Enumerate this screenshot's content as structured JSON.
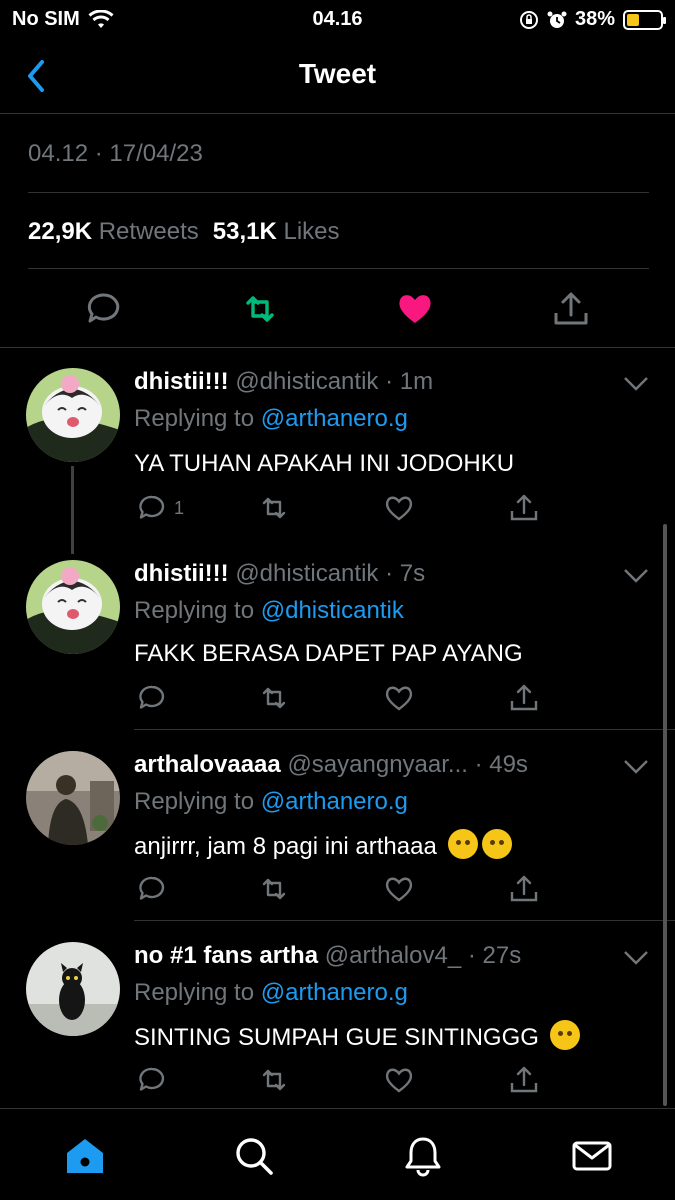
{
  "status_bar": {
    "carrier": "No SIM",
    "time": "04.16",
    "battery": "38%"
  },
  "nav": {
    "title": "Tweet"
  },
  "tweet": {
    "timestamp": "04.12 · 17/04/23",
    "retweets_count": "22,9K",
    "retweets_label": "Retweets",
    "likes_count": "53,1K",
    "likes_label": "Likes"
  },
  "replies": [
    {
      "display_name": "dhistii!!!",
      "handle": "@dhisticantik · 1m",
      "replying_label": "Replying to",
      "replying_to": "@arthanero.g",
      "text": "YA TUHAN APAKAH INI JODOHKU",
      "reply_count": "1"
    },
    {
      "display_name": "dhistii!!!",
      "handle": "@dhisticantik · 7s",
      "replying_label": "Replying to",
      "replying_to": "@dhisticantik",
      "text": "FAKK BERASA DAPET PAP AYANG",
      "reply_count": ""
    },
    {
      "display_name": "arthalovaaaa",
      "handle": "@sayangnyaar... · 49s",
      "replying_label": "Replying to",
      "replying_to": "@arthanero.g",
      "text": "anjirrr, jam 8 pagi ini arthaaa",
      "reply_count": ""
    },
    {
      "display_name": "no #1 fans artha",
      "handle": "@arthalov4_ · 27s",
      "replying_label": "Replying to",
      "replying_to": "@arthanero.g",
      "text": "SINTING SUMPAH GUE SINTINGGG",
      "reply_count": ""
    }
  ],
  "colors": {
    "accent": "#1d9bf0",
    "retweet": "#00ba7c",
    "like": "#f91880",
    "muted": "#71767b"
  },
  "tabs": [
    "home-icon",
    "search-icon",
    "notifications-icon",
    "messages-icon"
  ]
}
